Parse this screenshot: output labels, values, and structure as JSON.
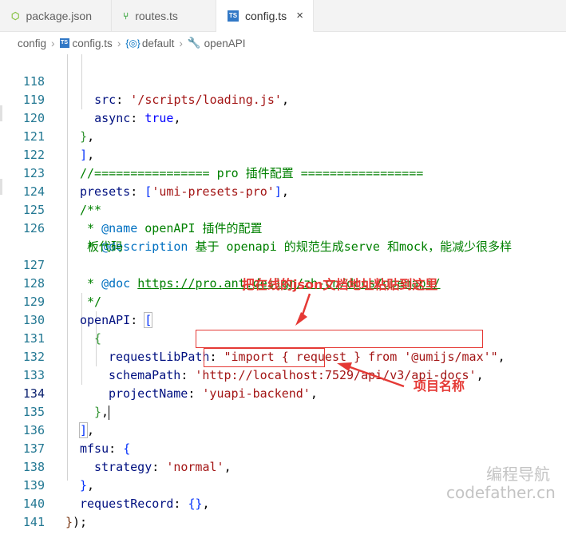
{
  "tabs": [
    {
      "label": "package.json",
      "icon": "npm-icon",
      "active": false
    },
    {
      "label": "routes.ts",
      "icon": "branch-icon",
      "active": false
    },
    {
      "label": "config.ts",
      "icon": "typescript-icon",
      "active": true
    }
  ],
  "close_glyph": "×",
  "ts_badge": "TS",
  "breadcrumb": {
    "items": [
      "config",
      "config.ts",
      "default",
      "openAPI"
    ]
  },
  "line_numbers": [
    "118",
    "119",
    "120",
    "121",
    "122",
    "123",
    "124",
    "125",
    "126",
    "127",
    "128",
    "129",
    "130",
    "131",
    "132",
    "133",
    "134",
    "135",
    "136",
    "137",
    "138",
    "139",
    "140",
    "141"
  ],
  "code": {
    "l118_key": "src",
    "l118_val": "'/scripts/loading.js'",
    "l119_key": "async",
    "l119_val": "true",
    "l122_comment": "//================ pro 插件配置 =================",
    "l123_key": "presets",
    "l123_val": "'umi-presets-pro'",
    "l124": "/**",
    "l125_star": " * ",
    "l125_tag": "@name",
    "l125_text": " openAPI 插件的配置",
    "l126_tag": "@description",
    "l126_text": " 基于 openapi 的规范生成serve 和mock，能减少很多样",
    "l126_cont": "板代码",
    "l127_tag": "@doc",
    "l127_url": "https://pro.ant.design/zh-cn/docs/openapi/",
    "l128": " */",
    "l129_key": "openAPI",
    "l131_key": "requestLibPath",
    "l131_val": "\"import { request } from '@umijs/max'\"",
    "l132_key": "schemaPath",
    "l132_val": "'http://localhost:7529/api/v3/api-docs'",
    "l133_key": "projectName",
    "l133_val": "'yuapi-backend'",
    "l136_key": "mfsu",
    "l137_key": "strategy",
    "l137_val": "'normal'",
    "l139_key": "requestRecord"
  },
  "annotations": {
    "top": "把在线的json文档地址粘贴到这里",
    "bottom": "项目名称"
  },
  "watermark": {
    "line1": "编程导航",
    "line2": "codefather.cn"
  },
  "colors": {
    "annotation": "#e53935",
    "keyword": "#0000ff",
    "string": "#a31515",
    "comment": "#008000"
  }
}
